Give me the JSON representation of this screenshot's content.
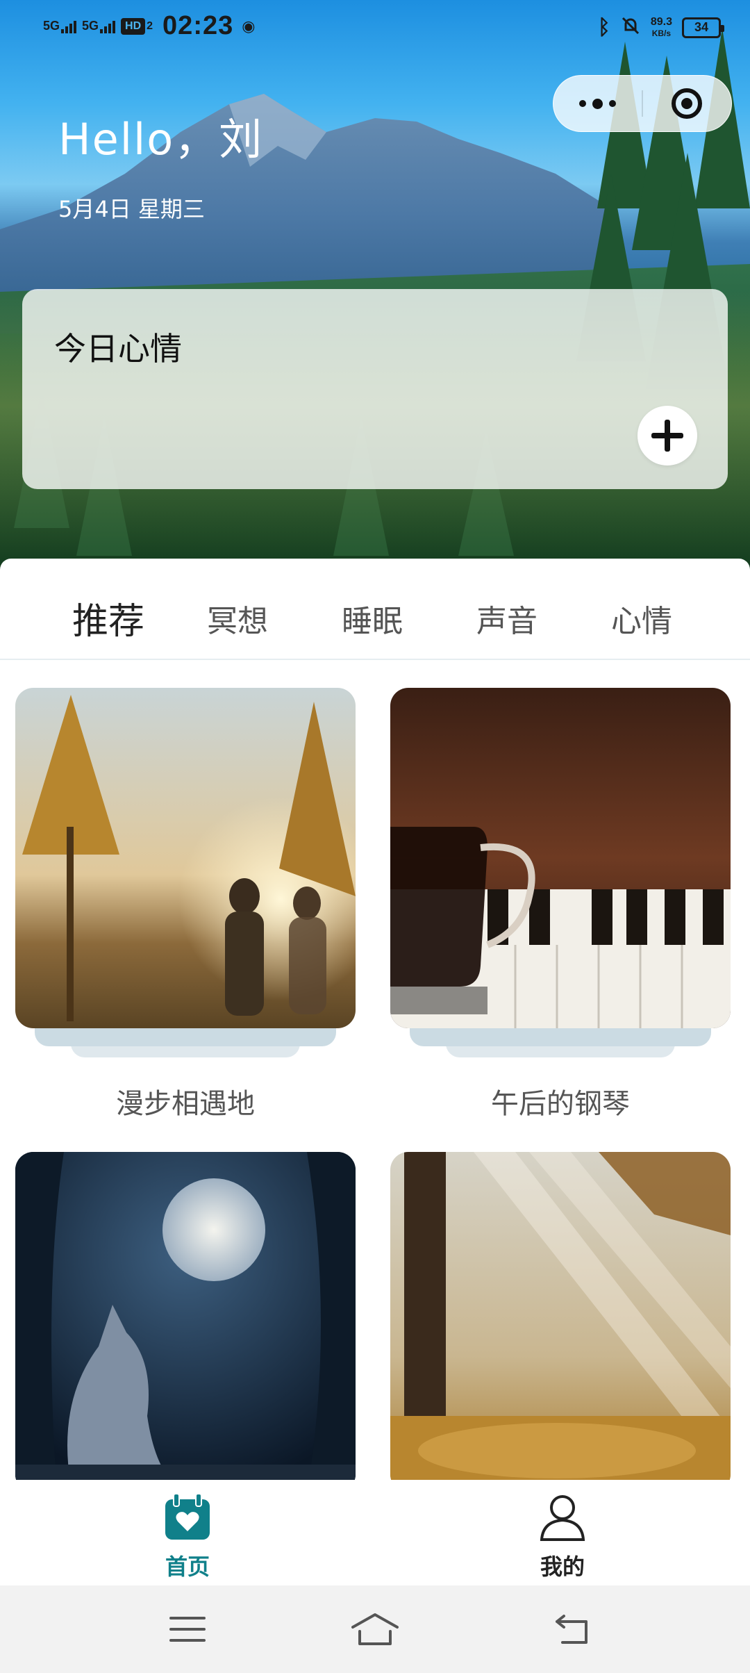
{
  "status_bar": {
    "signal1": "5G",
    "signal2": "5G",
    "hd": "HD",
    "hd_sub": "2",
    "time": "02:23",
    "net_speed_value": "89.3",
    "net_speed_unit": "KB/s",
    "battery": "34"
  },
  "hero": {
    "greeting": "Hello，刘",
    "date": "5月4日 星期三"
  },
  "mood_card": {
    "title": "今日心情"
  },
  "tabs": [
    {
      "label": "推荐",
      "active": true
    },
    {
      "label": "冥想",
      "active": false
    },
    {
      "label": "睡眠",
      "active": false
    },
    {
      "label": "声音",
      "active": false
    },
    {
      "label": "心情",
      "active": false
    }
  ],
  "cards": [
    {
      "caption": "漫步相遇地",
      "image": "couple-walking-forest-sunset"
    },
    {
      "caption": "午后的钢琴",
      "image": "coffee-cup-on-piano"
    },
    {
      "caption": "",
      "image": "cat-under-full-moon"
    },
    {
      "caption": "",
      "image": "sunbeams-autumn-forest"
    }
  ],
  "bottom_nav": {
    "home_label": "首页",
    "mine_label": "我的"
  },
  "colors": {
    "accent": "#10808a",
    "sheet_bg": "#ffffff",
    "nav_bg": "#f2f2f2"
  }
}
